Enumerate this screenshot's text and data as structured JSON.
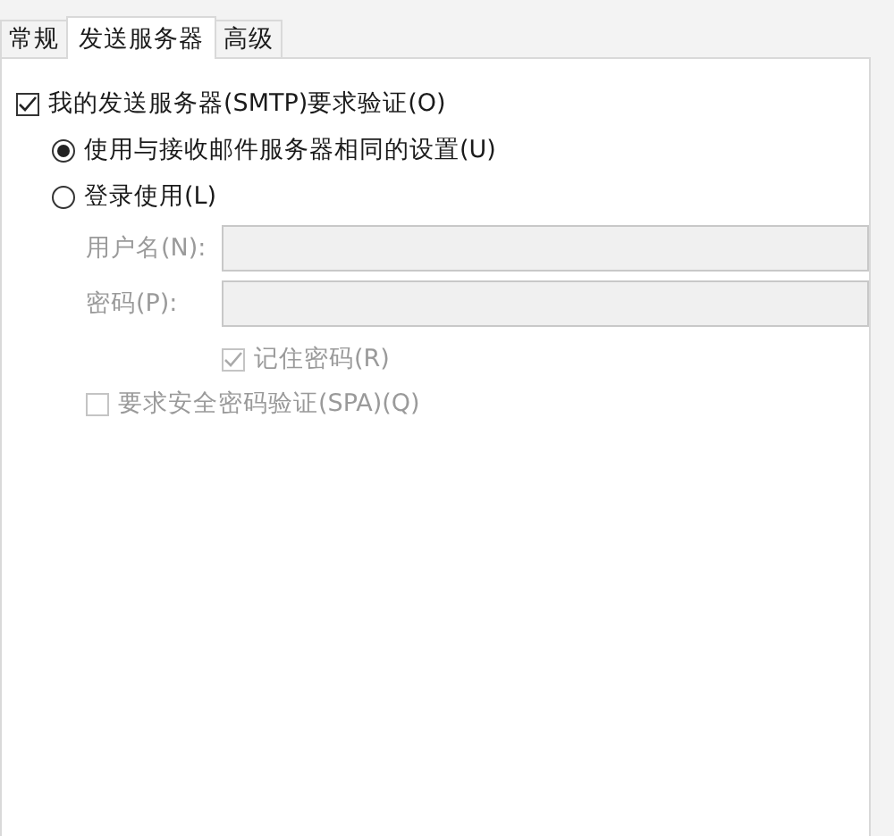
{
  "tabs": [
    {
      "label": "常规",
      "selected": false
    },
    {
      "label": "发送服务器",
      "selected": true
    },
    {
      "label": "高级",
      "selected": false
    }
  ],
  "require_auth": {
    "label": "我的发送服务器(SMTP)要求验证(O)",
    "checked": true
  },
  "auth_options": [
    {
      "label": "使用与接收邮件服务器相同的设置(U)",
      "selected": true
    },
    {
      "label": "登录使用(L)",
      "selected": false
    }
  ],
  "fields": [
    {
      "label": "用户名(N):",
      "disabled": true
    },
    {
      "label": "密码(P):",
      "disabled": true
    }
  ],
  "remember_password": {
    "label": "记住密码(R)",
    "checked": true,
    "disabled": true
  },
  "spa": {
    "label": "要求安全密码验证(SPA)(Q)",
    "checked": false,
    "disabled": true
  }
}
